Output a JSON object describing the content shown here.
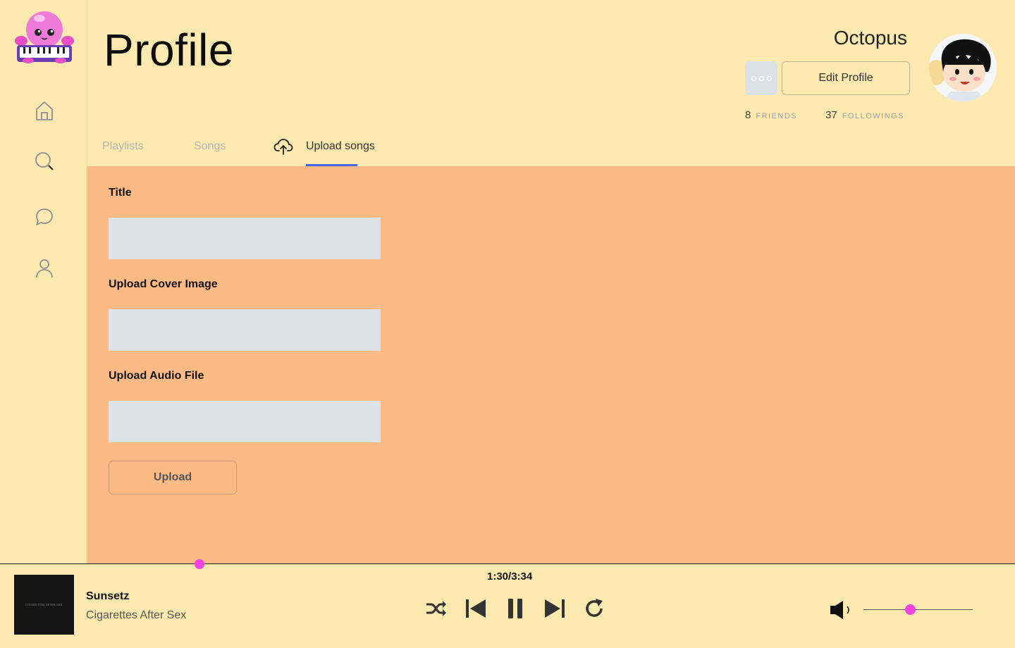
{
  "page": {
    "title": "Profile"
  },
  "profile": {
    "username": "Octopus",
    "edit_label": "Edit Profile",
    "friends_count": "8",
    "friends_label": "FRIENDS",
    "followings_count": "37",
    "followings_label": "FOLLOWINGS"
  },
  "tabs": [
    {
      "label": "Playlists",
      "active": false
    },
    {
      "label": "Songs",
      "active": false
    },
    {
      "label": "Upload songs",
      "active": true
    }
  ],
  "form": {
    "title_label": "Title",
    "cover_label": "Upload Cover Image",
    "audio_label": "Upload Audio File",
    "upload_label": "Upload"
  },
  "player": {
    "song_title": "Sunsetz",
    "artist": "Cigarettes After Sex",
    "cover_text": "CIGARETTES AFTER SEX",
    "time": "1:30/3:34",
    "accent_color": "#f043e0"
  },
  "icons": {
    "nav": [
      "home-icon",
      "search-icon",
      "chat-icon",
      "user-icon"
    ],
    "controls": [
      "shuffle-icon",
      "skip-back-icon",
      "pause-icon",
      "skip-forward-icon",
      "repeat-icon",
      "volume-icon"
    ]
  },
  "colors": {
    "background": "#fce9b0",
    "content_panel": "#fdba85",
    "tab_indicator": "#4a63e7",
    "input_fill": "#dde2e6"
  }
}
